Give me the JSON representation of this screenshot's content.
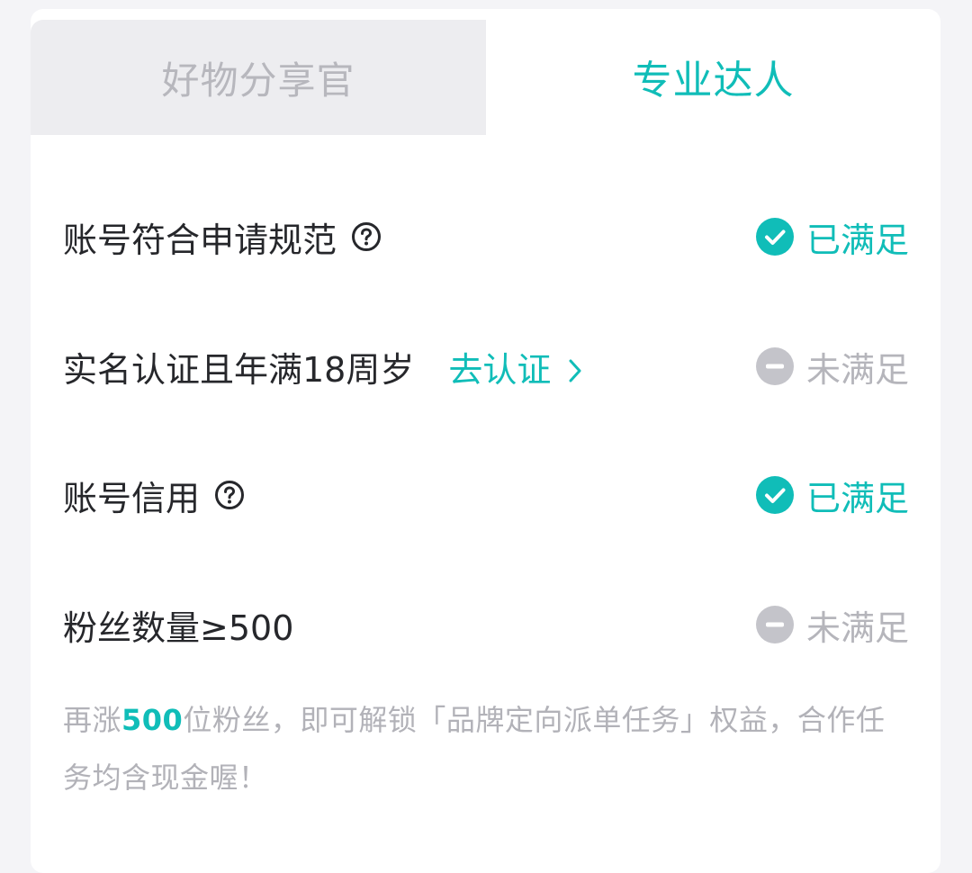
{
  "tabs": {
    "left_label": "好物分享官",
    "right_label": "专业达人"
  },
  "requirements": [
    {
      "label": "账号符合申请规范",
      "status": "已满足"
    },
    {
      "label": "实名认证且年满18周岁",
      "action": "去认证",
      "status": "未满足"
    },
    {
      "label": "账号信用",
      "status": "已满足"
    },
    {
      "label": "粉丝数量≥500",
      "status": "未满足"
    }
  ],
  "hint": {
    "prefix": "再涨",
    "count": "500",
    "suffix": "位粉丝，即可解锁「品牌定向派单任务」权益，合作任务均含现金喔！"
  },
  "colors": {
    "accent": "#10bdb8",
    "muted": "#b5b5bb",
    "text": "#26272b",
    "background": "#f4f4f7"
  },
  "icons": [
    "help-icon",
    "check-circle-icon",
    "minus-circle-icon",
    "chevron-right-icon"
  ]
}
